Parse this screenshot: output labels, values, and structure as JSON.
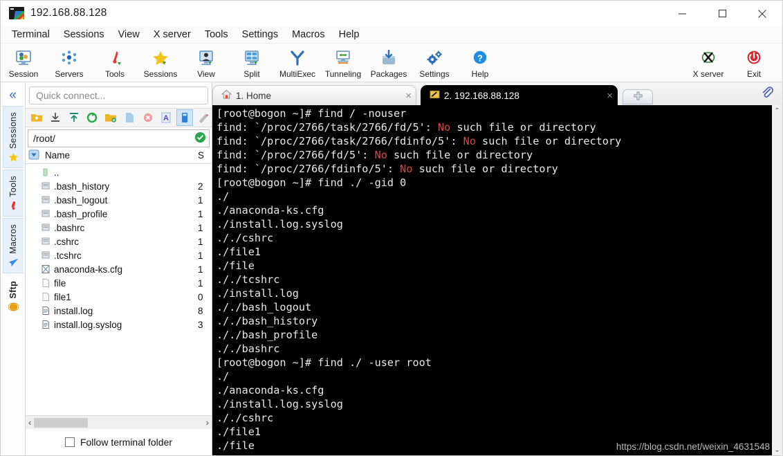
{
  "window": {
    "title": "192.168.88.128",
    "icon": "mobaxterm-icon",
    "minimize": "─",
    "maximize": "□",
    "close": "✕"
  },
  "menubar": {
    "items": [
      {
        "label": "Terminal"
      },
      {
        "label": "Sessions"
      },
      {
        "label": "View"
      },
      {
        "label": "X server"
      },
      {
        "label": "Tools"
      },
      {
        "label": "Settings"
      },
      {
        "label": "Macros"
      },
      {
        "label": "Help"
      }
    ]
  },
  "toolbar": {
    "buttons": [
      {
        "label": "Session",
        "icon": "session-icon"
      },
      {
        "label": "Servers",
        "icon": "servers-icon"
      },
      {
        "label": "Tools",
        "icon": "tools-icon"
      },
      {
        "label": "Sessions",
        "icon": "sessions-star-icon"
      },
      {
        "label": "View",
        "icon": "view-icon"
      },
      {
        "label": "Split",
        "icon": "split-icon"
      },
      {
        "label": "MultiExec",
        "icon": "multiexec-icon"
      },
      {
        "label": "Tunneling",
        "icon": "tunneling-icon"
      },
      {
        "label": "Packages",
        "icon": "packages-icon"
      },
      {
        "label": "Settings",
        "icon": "settings-gear-icon"
      },
      {
        "label": "Help",
        "icon": "help-icon"
      }
    ],
    "right_buttons": [
      {
        "label": "X server",
        "icon": "xserver-icon"
      },
      {
        "label": "Exit",
        "icon": "exit-power-icon"
      }
    ]
  },
  "sidebar": {
    "collapse_icon": "«",
    "tabs": [
      {
        "label": "Sessions",
        "icon": "star-icon",
        "active": true
      },
      {
        "label": "Tools",
        "icon": "tools-icon",
        "active": true
      },
      {
        "label": "Macros",
        "icon": "paper-plane-icon",
        "active": true
      },
      {
        "label": "Sftp",
        "icon": "sftp-globe-icon",
        "active": false
      }
    ]
  },
  "file_panel": {
    "quick_connect_placeholder": "Quick connect...",
    "toolbar_icons": [
      "folder-up-icon",
      "download-icon",
      "upload-icon",
      "refresh-icon",
      "new-folder-icon",
      "new-file-icon",
      "delete-icon",
      "text-mode-icon",
      "binary-mode-icon",
      "permissions-icon"
    ],
    "path": "/root/",
    "path_valid_icon": "check-icon",
    "columns": {
      "name": "Name",
      "size": "S"
    },
    "files": [
      {
        "name": "..",
        "size": "",
        "icon": "parent-dir-icon"
      },
      {
        "name": ".bash_history",
        "size": "2",
        "icon": "file-gray-icon"
      },
      {
        "name": ".bash_logout",
        "size": "1",
        "icon": "file-gray-icon"
      },
      {
        "name": ".bash_profile",
        "size": "1",
        "icon": "file-gray-icon"
      },
      {
        "name": ".bashrc",
        "size": "1",
        "icon": "file-gray-icon"
      },
      {
        "name": ".cshrc",
        "size": "1",
        "icon": "file-gray-icon"
      },
      {
        "name": ".tcshrc",
        "size": "1",
        "icon": "file-gray-icon"
      },
      {
        "name": "anaconda-ks.cfg",
        "size": "1",
        "icon": "cfg-file-icon"
      },
      {
        "name": "file",
        "size": "1",
        "icon": "blank-file-icon"
      },
      {
        "name": "file1",
        "size": "0",
        "icon": "blank-file-icon"
      },
      {
        "name": "install.log",
        "size": "8",
        "icon": "log-file-icon"
      },
      {
        "name": "install.log.syslog",
        "size": "3",
        "icon": "log-file-icon"
      }
    ],
    "hscroll_left": "‹",
    "hscroll_right": "›",
    "follow_label": "Follow terminal folder",
    "follow_checked": false
  },
  "tabs": {
    "items": [
      {
        "label": "1. Home",
        "icon": "home-icon",
        "active": false,
        "close": "×"
      },
      {
        "label": "2. 192.168.88.128",
        "icon": "terminal-icon",
        "active": true,
        "close": "×"
      }
    ],
    "new_tab_icon": "plus-icon",
    "clip_icon": "paperclip-icon"
  },
  "terminal": {
    "lines": [
      [
        {
          "t": "[root@bogon ~]# find / -nouser"
        }
      ],
      [
        {
          "t": "find: `/proc/2766/task/2766/fd/5': "
        },
        {
          "t": "No",
          "c": "red"
        },
        {
          "t": " such file or directory"
        }
      ],
      [
        {
          "t": "find: `/proc/2766/task/2766/fdinfo/5': "
        },
        {
          "t": "No",
          "c": "red"
        },
        {
          "t": " such file or directory"
        }
      ],
      [
        {
          "t": "find: `/proc/2766/fd/5': "
        },
        {
          "t": "No",
          "c": "red"
        },
        {
          "t": " such file or directory"
        }
      ],
      [
        {
          "t": "find: `/proc/2766/fdinfo/5': "
        },
        {
          "t": "No",
          "c": "red"
        },
        {
          "t": " such file or directory"
        }
      ],
      [
        {
          "t": "[root@bogon ~]# find ./ -gid 0"
        }
      ],
      [
        {
          "t": "./"
        }
      ],
      [
        {
          "t": "./anaconda-ks.cfg"
        }
      ],
      [
        {
          "t": "./install.log.syslog"
        }
      ],
      [
        {
          "t": "././cshrc"
        }
      ],
      [
        {
          "t": "./file1"
        }
      ],
      [
        {
          "t": "./file"
        }
      ],
      [
        {
          "t": "././tcshrc"
        }
      ],
      [
        {
          "t": "./install.log"
        }
      ],
      [
        {
          "t": "././bash_logout"
        }
      ],
      [
        {
          "t": "././bash_history"
        }
      ],
      [
        {
          "t": "././bash_profile"
        }
      ],
      [
        {
          "t": "././bashrc"
        }
      ],
      [
        {
          "t": "[root@bogon ~]# find ./ -user root"
        }
      ],
      [
        {
          "t": "./"
        }
      ],
      [
        {
          "t": "./anaconda-ks.cfg"
        }
      ],
      [
        {
          "t": "./install.log.syslog"
        }
      ],
      [
        {
          "t": "././cshrc"
        }
      ],
      [
        {
          "t": "./file1"
        }
      ],
      [
        {
          "t": "./file"
        }
      ]
    ],
    "scroll_up_icon": "⌃",
    "scroll_down_icon": "⌄",
    "watermark": "https://blog.csdn.net/weixin_4631548"
  },
  "colors": {
    "terminal_bg": "#000000",
    "terminal_fg": "#e8e8e8",
    "terminal_error": "#d6483f",
    "accent": "#2f6fb5",
    "exit_red": "#d8232a"
  }
}
